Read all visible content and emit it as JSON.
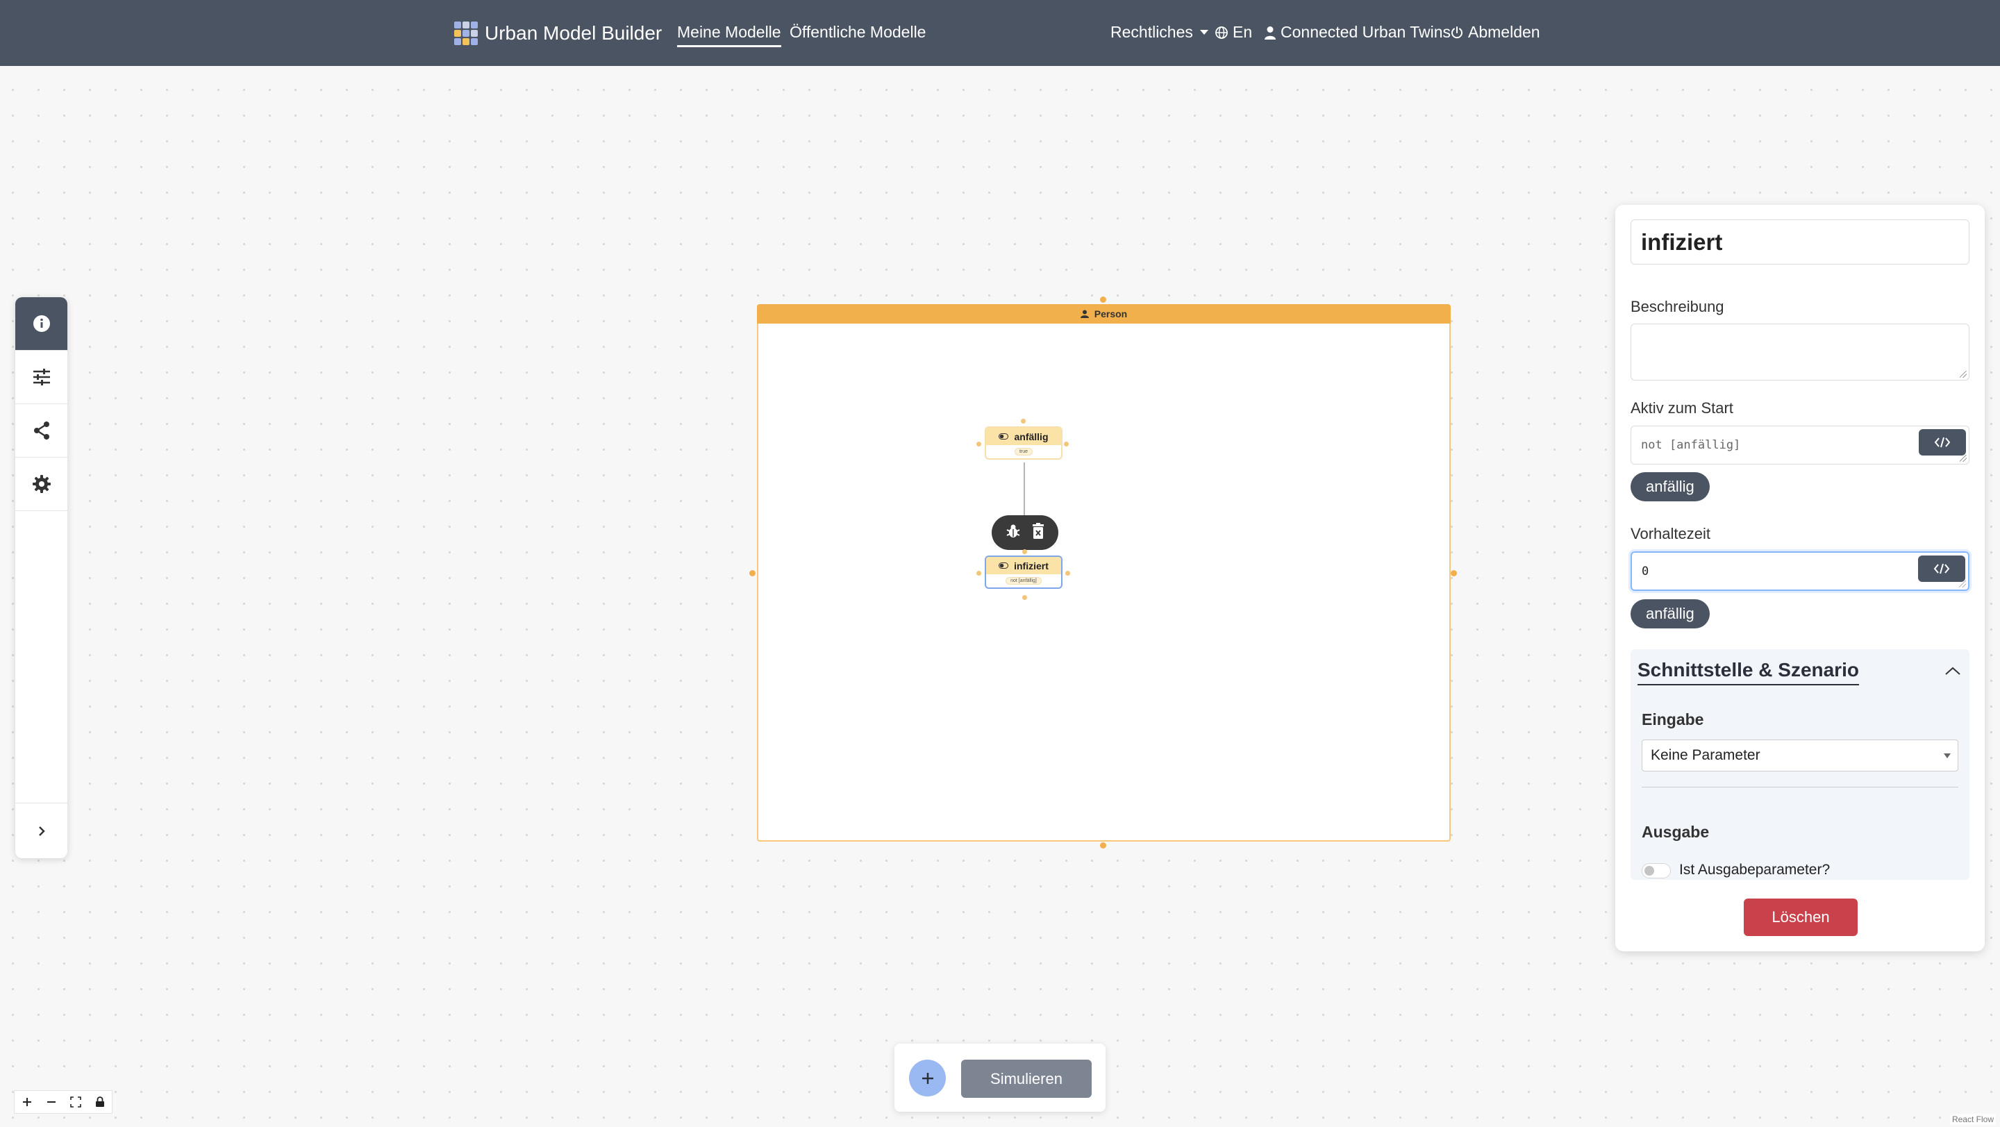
{
  "navbar": {
    "brand": "Urban Model Builder",
    "links": [
      {
        "label": "Meine Modelle",
        "active": true
      },
      {
        "label": "Öffentliche Modelle",
        "active": false
      }
    ],
    "legal": "Rechtliches",
    "language": "En",
    "user": "Connected Urban Twins",
    "logout": "Abmelden",
    "bg_color": "#4b5462"
  },
  "left_toolbar": {
    "items": [
      "info-icon",
      "sliders-icon",
      "share-icon",
      "gear-icon"
    ],
    "active_index": 0,
    "expand_icon": "chevron-right-icon"
  },
  "canvas": {
    "group": {
      "label": "Person",
      "color": "#f2b04d"
    },
    "nodes": [
      {
        "label": "anfällig",
        "expression": "true",
        "selected": false
      },
      {
        "label": "infiziert",
        "expression": "not [anfällig]",
        "selected": true
      }
    ],
    "node_toolbar": [
      "bug-icon",
      "delete-icon"
    ]
  },
  "panel": {
    "title": "infiziert",
    "description_label": "Beschreibung",
    "description_value": "",
    "active_label": "Aktiv zum Start",
    "active_value": "not [anfällig]",
    "active_chip": "anfällig",
    "delay_label": "Vorhaltezeit",
    "delay_value": "0",
    "delay_chip": "anfällig",
    "section_title": "Schnittstelle & Szenario",
    "input_label": "Eingabe",
    "input_select": "Keine Parameter",
    "output_label": "Ausgabe",
    "output_toggle_label": "Ist Ausgabeparameter?",
    "output_toggle_on": false,
    "delete_label": "Löschen",
    "delete_color": "#c9414b"
  },
  "bottom_bar": {
    "add_icon": "plus-icon",
    "simulate_label": "Simulieren"
  },
  "zoom_controls": [
    "plus-icon",
    "minus-icon",
    "fit-view-icon",
    "lock-icon"
  ],
  "attribution": "React Flow"
}
